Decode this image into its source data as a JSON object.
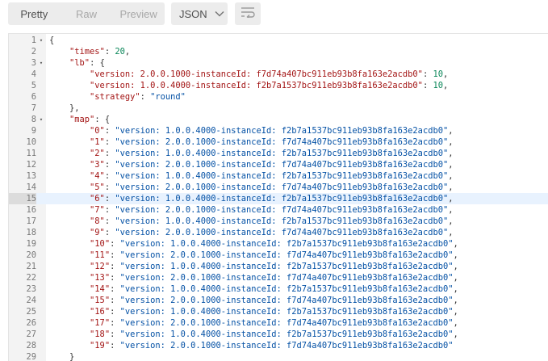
{
  "toolbar": {
    "view_modes": [
      "Pretty",
      "Raw",
      "Preview"
    ],
    "active_mode": "Pretty",
    "format_label": "JSON"
  },
  "editor": {
    "highlighted_line": 15,
    "lines": [
      {
        "n": "1",
        "fold": "▾",
        "tokens": [
          {
            "t": "p",
            "v": "{"
          }
        ]
      },
      {
        "n": "2",
        "fold": "",
        "tokens": [
          {
            "t": "p",
            "v": "    "
          },
          {
            "t": "k",
            "v": "\"times\""
          },
          {
            "t": "p",
            "v": ": "
          },
          {
            "t": "n",
            "v": "20"
          },
          {
            "t": "p",
            "v": ","
          }
        ]
      },
      {
        "n": "3",
        "fold": "▾",
        "tokens": [
          {
            "t": "p",
            "v": "    "
          },
          {
            "t": "k",
            "v": "\"lb\""
          },
          {
            "t": "p",
            "v": ": {"
          }
        ]
      },
      {
        "n": "4",
        "fold": "",
        "tokens": [
          {
            "t": "p",
            "v": "        "
          },
          {
            "t": "k",
            "v": "\"version: 2.0.0.1000-instanceId: f7d74a407bc911eb93b8fa163e2acdb0\""
          },
          {
            "t": "p",
            "v": ": "
          },
          {
            "t": "n",
            "v": "10"
          },
          {
            "t": "p",
            "v": ","
          }
        ]
      },
      {
        "n": "5",
        "fold": "",
        "tokens": [
          {
            "t": "p",
            "v": "        "
          },
          {
            "t": "k",
            "v": "\"version: 1.0.0.4000-instanceId: f2b7a1537bc911eb93b8fa163e2acdb0\""
          },
          {
            "t": "p",
            "v": ": "
          },
          {
            "t": "n",
            "v": "10"
          },
          {
            "t": "p",
            "v": ","
          }
        ]
      },
      {
        "n": "6",
        "fold": "",
        "tokens": [
          {
            "t": "p",
            "v": "        "
          },
          {
            "t": "k",
            "v": "\"strategy\""
          },
          {
            "t": "p",
            "v": ": "
          },
          {
            "t": "s",
            "v": "\"round\""
          }
        ]
      },
      {
        "n": "7",
        "fold": "",
        "tokens": [
          {
            "t": "p",
            "v": "    },"
          }
        ]
      },
      {
        "n": "8",
        "fold": "▾",
        "tokens": [
          {
            "t": "p",
            "v": "    "
          },
          {
            "t": "k",
            "v": "\"map\""
          },
          {
            "t": "p",
            "v": ": {"
          }
        ]
      },
      {
        "n": "9",
        "fold": "",
        "tokens": [
          {
            "t": "p",
            "v": "        "
          },
          {
            "t": "k",
            "v": "\"0\""
          },
          {
            "t": "p",
            "v": ": "
          },
          {
            "t": "s",
            "v": "\"version: 1.0.0.4000-instanceId: f2b7a1537bc911eb93b8fa163e2acdb0\""
          },
          {
            "t": "p",
            "v": ","
          }
        ]
      },
      {
        "n": "10",
        "fold": "",
        "tokens": [
          {
            "t": "p",
            "v": "        "
          },
          {
            "t": "k",
            "v": "\"1\""
          },
          {
            "t": "p",
            "v": ": "
          },
          {
            "t": "s",
            "v": "\"version: 2.0.0.1000-instanceId: f7d74a407bc911eb93b8fa163e2acdb0\""
          },
          {
            "t": "p",
            "v": ","
          }
        ]
      },
      {
        "n": "11",
        "fold": "",
        "tokens": [
          {
            "t": "p",
            "v": "        "
          },
          {
            "t": "k",
            "v": "\"2\""
          },
          {
            "t": "p",
            "v": ": "
          },
          {
            "t": "s",
            "v": "\"version: 1.0.0.4000-instanceId: f2b7a1537bc911eb93b8fa163e2acdb0\""
          },
          {
            "t": "p",
            "v": ","
          }
        ]
      },
      {
        "n": "12",
        "fold": "",
        "tokens": [
          {
            "t": "p",
            "v": "        "
          },
          {
            "t": "k",
            "v": "\"3\""
          },
          {
            "t": "p",
            "v": ": "
          },
          {
            "t": "s",
            "v": "\"version: 2.0.0.1000-instanceId: f7d74a407bc911eb93b8fa163e2acdb0\""
          },
          {
            "t": "p",
            "v": ","
          }
        ]
      },
      {
        "n": "13",
        "fold": "",
        "tokens": [
          {
            "t": "p",
            "v": "        "
          },
          {
            "t": "k",
            "v": "\"4\""
          },
          {
            "t": "p",
            "v": ": "
          },
          {
            "t": "s",
            "v": "\"version: 1.0.0.4000-instanceId: f2b7a1537bc911eb93b8fa163e2acdb0\""
          },
          {
            "t": "p",
            "v": ","
          }
        ]
      },
      {
        "n": "14",
        "fold": "",
        "tokens": [
          {
            "t": "p",
            "v": "        "
          },
          {
            "t": "k",
            "v": "\"5\""
          },
          {
            "t": "p",
            "v": ": "
          },
          {
            "t": "s",
            "v": "\"version: 2.0.0.1000-instanceId: f7d74a407bc911eb93b8fa163e2acdb0\""
          },
          {
            "t": "p",
            "v": ","
          }
        ]
      },
      {
        "n": "15",
        "fold": "",
        "tokens": [
          {
            "t": "p",
            "v": "        "
          },
          {
            "t": "k",
            "v": "\"6\""
          },
          {
            "t": "p",
            "v": ": "
          },
          {
            "t": "s",
            "v": "\"version: 1.0.0.4000-instanceId: f2b7a1537bc911eb93b8fa163e2acdb0\""
          },
          {
            "t": "p",
            "v": ","
          }
        ]
      },
      {
        "n": "16",
        "fold": "",
        "tokens": [
          {
            "t": "p",
            "v": "        "
          },
          {
            "t": "k",
            "v": "\"7\""
          },
          {
            "t": "p",
            "v": ": "
          },
          {
            "t": "s",
            "v": "\"version: 2.0.0.1000-instanceId: f7d74a407bc911eb93b8fa163e2acdb0\""
          },
          {
            "t": "p",
            "v": ","
          }
        ]
      },
      {
        "n": "17",
        "fold": "",
        "tokens": [
          {
            "t": "p",
            "v": "        "
          },
          {
            "t": "k",
            "v": "\"8\""
          },
          {
            "t": "p",
            "v": ": "
          },
          {
            "t": "s",
            "v": "\"version: 1.0.0.4000-instanceId: f2b7a1537bc911eb93b8fa163e2acdb0\""
          },
          {
            "t": "p",
            "v": ","
          }
        ]
      },
      {
        "n": "18",
        "fold": "",
        "tokens": [
          {
            "t": "p",
            "v": "        "
          },
          {
            "t": "k",
            "v": "\"9\""
          },
          {
            "t": "p",
            "v": ": "
          },
          {
            "t": "s",
            "v": "\"version: 2.0.0.1000-instanceId: f7d74a407bc911eb93b8fa163e2acdb0\""
          },
          {
            "t": "p",
            "v": ","
          }
        ]
      },
      {
        "n": "19",
        "fold": "",
        "tokens": [
          {
            "t": "p",
            "v": "        "
          },
          {
            "t": "k",
            "v": "\"10\""
          },
          {
            "t": "p",
            "v": ": "
          },
          {
            "t": "s",
            "v": "\"version: 1.0.0.4000-instanceId: f2b7a1537bc911eb93b8fa163e2acdb0\""
          },
          {
            "t": "p",
            "v": ","
          }
        ]
      },
      {
        "n": "20",
        "fold": "",
        "tokens": [
          {
            "t": "p",
            "v": "        "
          },
          {
            "t": "k",
            "v": "\"11\""
          },
          {
            "t": "p",
            "v": ": "
          },
          {
            "t": "s",
            "v": "\"version: 2.0.0.1000-instanceId: f7d74a407bc911eb93b8fa163e2acdb0\""
          },
          {
            "t": "p",
            "v": ","
          }
        ]
      },
      {
        "n": "21",
        "fold": "",
        "tokens": [
          {
            "t": "p",
            "v": "        "
          },
          {
            "t": "k",
            "v": "\"12\""
          },
          {
            "t": "p",
            "v": ": "
          },
          {
            "t": "s",
            "v": "\"version: 1.0.0.4000-instanceId: f2b7a1537bc911eb93b8fa163e2acdb0\""
          },
          {
            "t": "p",
            "v": ","
          }
        ]
      },
      {
        "n": "22",
        "fold": "",
        "tokens": [
          {
            "t": "p",
            "v": "        "
          },
          {
            "t": "k",
            "v": "\"13\""
          },
          {
            "t": "p",
            "v": ": "
          },
          {
            "t": "s",
            "v": "\"version: 2.0.0.1000-instanceId: f7d74a407bc911eb93b8fa163e2acdb0\""
          },
          {
            "t": "p",
            "v": ","
          }
        ]
      },
      {
        "n": "23",
        "fold": "",
        "tokens": [
          {
            "t": "p",
            "v": "        "
          },
          {
            "t": "k",
            "v": "\"14\""
          },
          {
            "t": "p",
            "v": ": "
          },
          {
            "t": "s",
            "v": "\"version: 1.0.0.4000-instanceId: f2b7a1537bc911eb93b8fa163e2acdb0\""
          },
          {
            "t": "p",
            "v": ","
          }
        ]
      },
      {
        "n": "24",
        "fold": "",
        "tokens": [
          {
            "t": "p",
            "v": "        "
          },
          {
            "t": "k",
            "v": "\"15\""
          },
          {
            "t": "p",
            "v": ": "
          },
          {
            "t": "s",
            "v": "\"version: 2.0.0.1000-instanceId: f7d74a407bc911eb93b8fa163e2acdb0\""
          },
          {
            "t": "p",
            "v": ","
          }
        ]
      },
      {
        "n": "25",
        "fold": "",
        "tokens": [
          {
            "t": "p",
            "v": "        "
          },
          {
            "t": "k",
            "v": "\"16\""
          },
          {
            "t": "p",
            "v": ": "
          },
          {
            "t": "s",
            "v": "\"version: 1.0.0.4000-instanceId: f2b7a1537bc911eb93b8fa163e2acdb0\""
          },
          {
            "t": "p",
            "v": ","
          }
        ]
      },
      {
        "n": "26",
        "fold": "",
        "tokens": [
          {
            "t": "p",
            "v": "        "
          },
          {
            "t": "k",
            "v": "\"17\""
          },
          {
            "t": "p",
            "v": ": "
          },
          {
            "t": "s",
            "v": "\"version: 2.0.0.1000-instanceId: f7d74a407bc911eb93b8fa163e2acdb0\""
          },
          {
            "t": "p",
            "v": ","
          }
        ]
      },
      {
        "n": "27",
        "fold": "",
        "tokens": [
          {
            "t": "p",
            "v": "        "
          },
          {
            "t": "k",
            "v": "\"18\""
          },
          {
            "t": "p",
            "v": ": "
          },
          {
            "t": "s",
            "v": "\"version: 1.0.0.4000-instanceId: f2b7a1537bc911eb93b8fa163e2acdb0\""
          },
          {
            "t": "p",
            "v": ","
          }
        ]
      },
      {
        "n": "28",
        "fold": "",
        "tokens": [
          {
            "t": "p",
            "v": "        "
          },
          {
            "t": "k",
            "v": "\"19\""
          },
          {
            "t": "p",
            "v": ": "
          },
          {
            "t": "s",
            "v": "\"version: 2.0.0.1000-instanceId: f7d74a407bc911eb93b8fa163e2acdb0\""
          }
        ]
      },
      {
        "n": "29",
        "fold": "",
        "tokens": [
          {
            "t": "p",
            "v": "    }"
          }
        ]
      }
    ]
  }
}
